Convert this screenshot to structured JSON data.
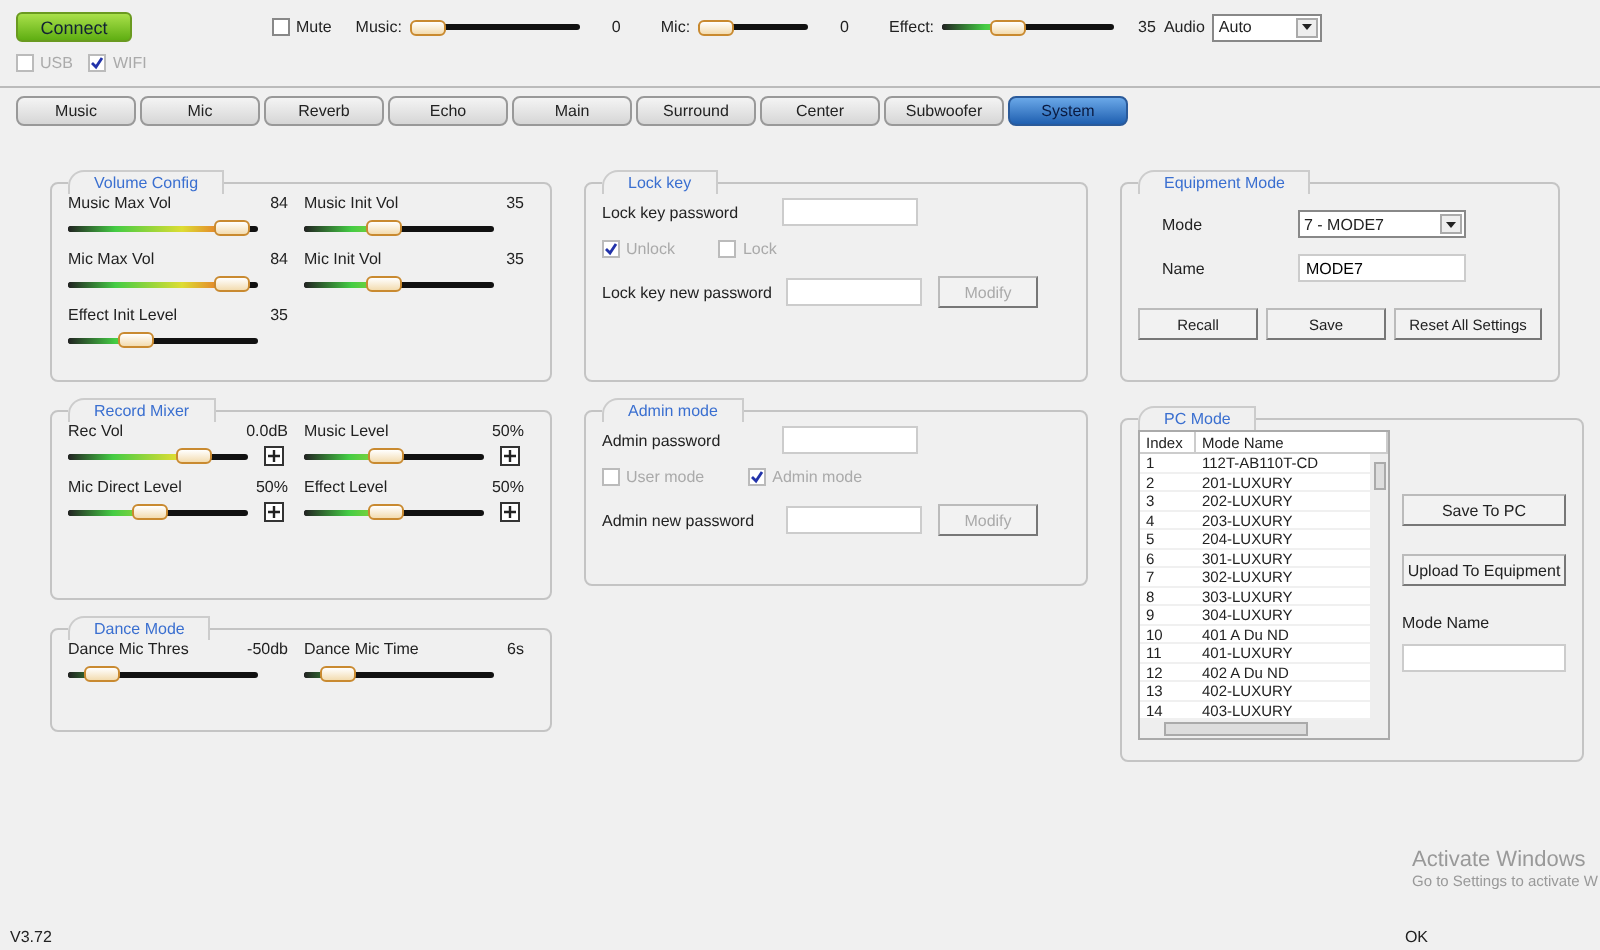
{
  "top_bar": {
    "connect_button": "Connect",
    "mute": {
      "label": "Mute",
      "checked": false
    },
    "sliders": [
      {
        "label": "Music:",
        "level": 0,
        "reading": "0"
      },
      {
        "label": "Mic:",
        "level": 0,
        "reading": "0"
      },
      {
        "label": "Effect:",
        "level": 0.35,
        "reading": "35"
      }
    ],
    "audio": {
      "label": "Audio",
      "value": "Auto"
    },
    "connection": [
      {
        "label": "USB",
        "checked": false,
        "disabled": true
      },
      {
        "label": "WIFI",
        "checked": true,
        "disabled": true
      }
    ]
  },
  "tabs": [
    {
      "label": "Music",
      "selected": false
    },
    {
      "label": "Mic",
      "selected": false
    },
    {
      "label": "Reverb",
      "selected": false
    },
    {
      "label": "Echo",
      "selected": false
    },
    {
      "label": "Main",
      "selected": false
    },
    {
      "label": "Surround",
      "selected": false
    },
    {
      "label": "Center",
      "selected": false
    },
    {
      "label": "Subwoofer",
      "selected": false
    },
    {
      "label": "System",
      "selected": true
    }
  ],
  "volume_config": {
    "title": "Volume Config",
    "sliders": [
      {
        "label": "Music Max Vol",
        "reading": "84",
        "level": 0.95
      },
      {
        "label": "Music Init Vol",
        "reading": "35",
        "level": 0.4
      },
      {
        "label": "Mic Max Vol",
        "reading": "84",
        "level": 0.95
      },
      {
        "label": "Mic Init Vol",
        "reading": "35",
        "level": 0.4
      },
      {
        "label": "Effect Init Level",
        "reading": "35",
        "level": 0.33
      }
    ]
  },
  "record_mixer": {
    "title": "Record Mixer",
    "sliders": [
      {
        "label": "Rec Vol",
        "reading": "0.0dB",
        "level": 0.75
      },
      {
        "label": "Music Level",
        "reading": "50%",
        "level": 0.45
      },
      {
        "label": "Mic Direct Level",
        "reading": "50%",
        "level": 0.45
      },
      {
        "label": "Effect Level",
        "reading": "50%",
        "level": 0.45
      }
    ]
  },
  "dance_mode": {
    "title": "Dance Mode",
    "sliders": [
      {
        "label": "Dance Mic Thres",
        "reading": "-50db",
        "level": 0.1
      },
      {
        "label": "Dance Mic Time",
        "reading": "6s",
        "level": 0.1
      }
    ]
  },
  "lock_key": {
    "title": "Lock key",
    "password_label": "Lock key password",
    "options": [
      {
        "label": "Unlock",
        "checked": true,
        "disabled": true
      },
      {
        "label": "Lock",
        "checked": false,
        "disabled": true
      }
    ],
    "new_password_label": "Lock key new password",
    "modify": {
      "label": "Modify",
      "disabled": true
    }
  },
  "admin_mode": {
    "title": "Admin mode",
    "password_label": "Admin password",
    "options": [
      {
        "label": "User mode",
        "checked": false,
        "disabled": true
      },
      {
        "label": "Admin mode",
        "checked": true,
        "disabled": true
      }
    ],
    "new_password_label": "Admin new password",
    "modify": {
      "label": "Modify",
      "disabled": true
    }
  },
  "equipment_mode": {
    "title": "Equipment Mode",
    "mode_label": "Mode",
    "mode_value": "7 - MODE7",
    "name_label": "Name",
    "name_value": "MODE7",
    "buttons": [
      "Recall",
      "Save",
      "Reset All Settings"
    ]
  },
  "pc_mode": {
    "title": "PC Mode",
    "columns": [
      "Index",
      "Mode Name"
    ],
    "rows": [
      [
        "1",
        "112T-AB110T-CD"
      ],
      [
        "2",
        "201-LUXURY"
      ],
      [
        "3",
        "202-LUXURY"
      ],
      [
        "4",
        "203-LUXURY"
      ],
      [
        "5",
        "204-LUXURY"
      ],
      [
        "6",
        "301-LUXURY"
      ],
      [
        "7",
        "302-LUXURY"
      ],
      [
        "8",
        "303-LUXURY"
      ],
      [
        "9",
        "304-LUXURY"
      ],
      [
        "10",
        "401 A Du ND"
      ],
      [
        "11",
        "401-LUXURY"
      ],
      [
        "12",
        "402 A Du ND"
      ],
      [
        "13",
        "402-LUXURY"
      ],
      [
        "14",
        "403-LUXURY"
      ]
    ],
    "buttons": [
      "Save To PC",
      "Upload To Equipment"
    ],
    "mode_name_label": "Mode Name"
  },
  "os_notice": {
    "title": "Activate Windows",
    "subtitle": "Go to Settings to activate W"
  },
  "status_bar": {
    "version": "V3.72",
    "status": "OK"
  }
}
